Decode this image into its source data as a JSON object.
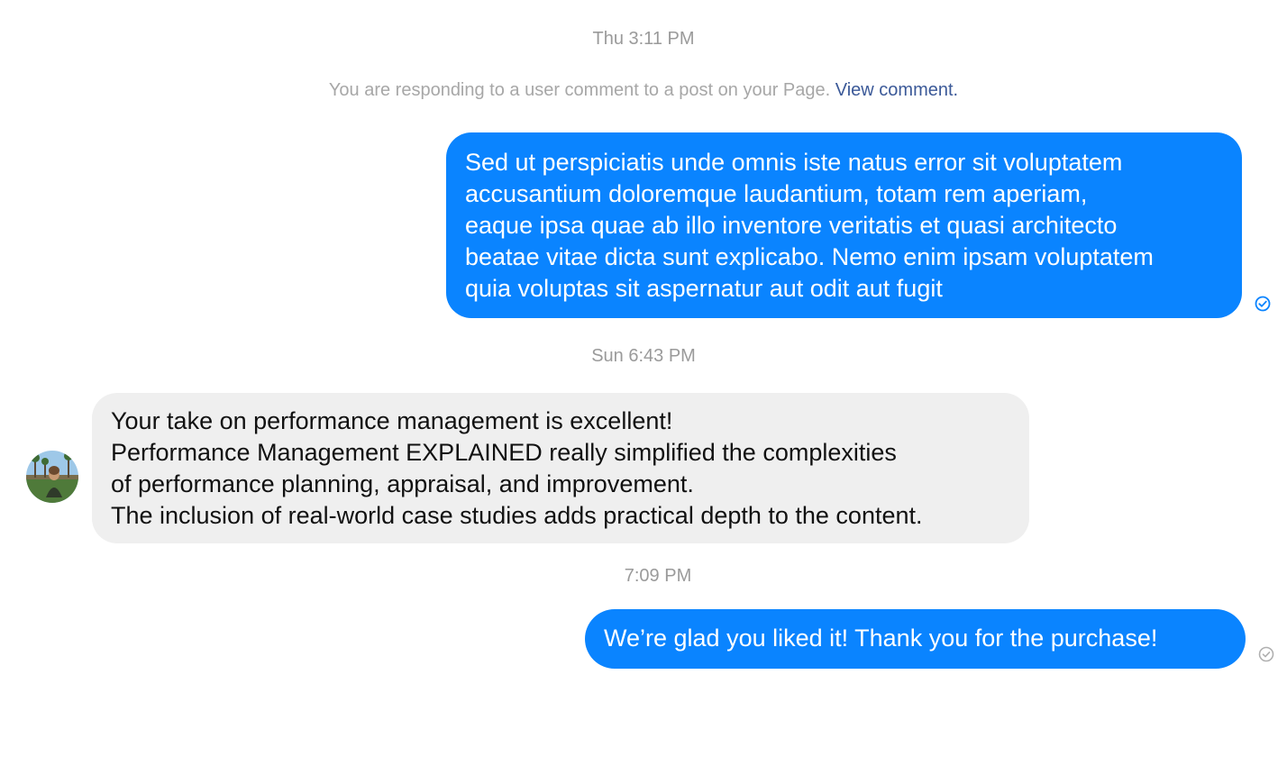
{
  "timestamps": {
    "first": "Thu 3:11 PM",
    "second": "Sun 6:43 PM",
    "third": "7:09 PM"
  },
  "context_note": {
    "text": "You are responding to a user comment to a post on your Page.",
    "link_label": "View comment."
  },
  "messages": [
    {
      "direction": "outgoing",
      "lines": [
        "Sed ut perspiciatis unde omnis iste natus error sit voluptatem",
        "accusantium doloremque laudantium, totam rem aperiam,",
        "eaque ipsa quae ab illo inventore veritatis et quasi architecto",
        "beatae vitae dicta sunt explicabo. Nemo enim ipsam voluptatem",
        "quia voluptas sit aspernatur aut odit aut fugit"
      ],
      "status": "delivered"
    },
    {
      "direction": "incoming",
      "lines": [
        "Your take on performance management is excellent!",
        "Performance Management EXPLAINED really simplified the complexities",
        "of performance planning, appraisal, and improvement.",
        "The inclusion of real-world case studies adds practical depth to the content."
      ]
    },
    {
      "direction": "outgoing",
      "lines": [
        "We’re glad you liked it! Thank you for the purchase!"
      ],
      "status": "sent"
    }
  ],
  "icons": {
    "delivered": "check-circle-icon",
    "sent": "check-circle-outline-icon"
  },
  "colors": {
    "outgoing_bubble": "#0a84ff",
    "incoming_bubble": "#efefef",
    "timestamp_text": "#9a9a9a",
    "link": "#3b5998"
  }
}
